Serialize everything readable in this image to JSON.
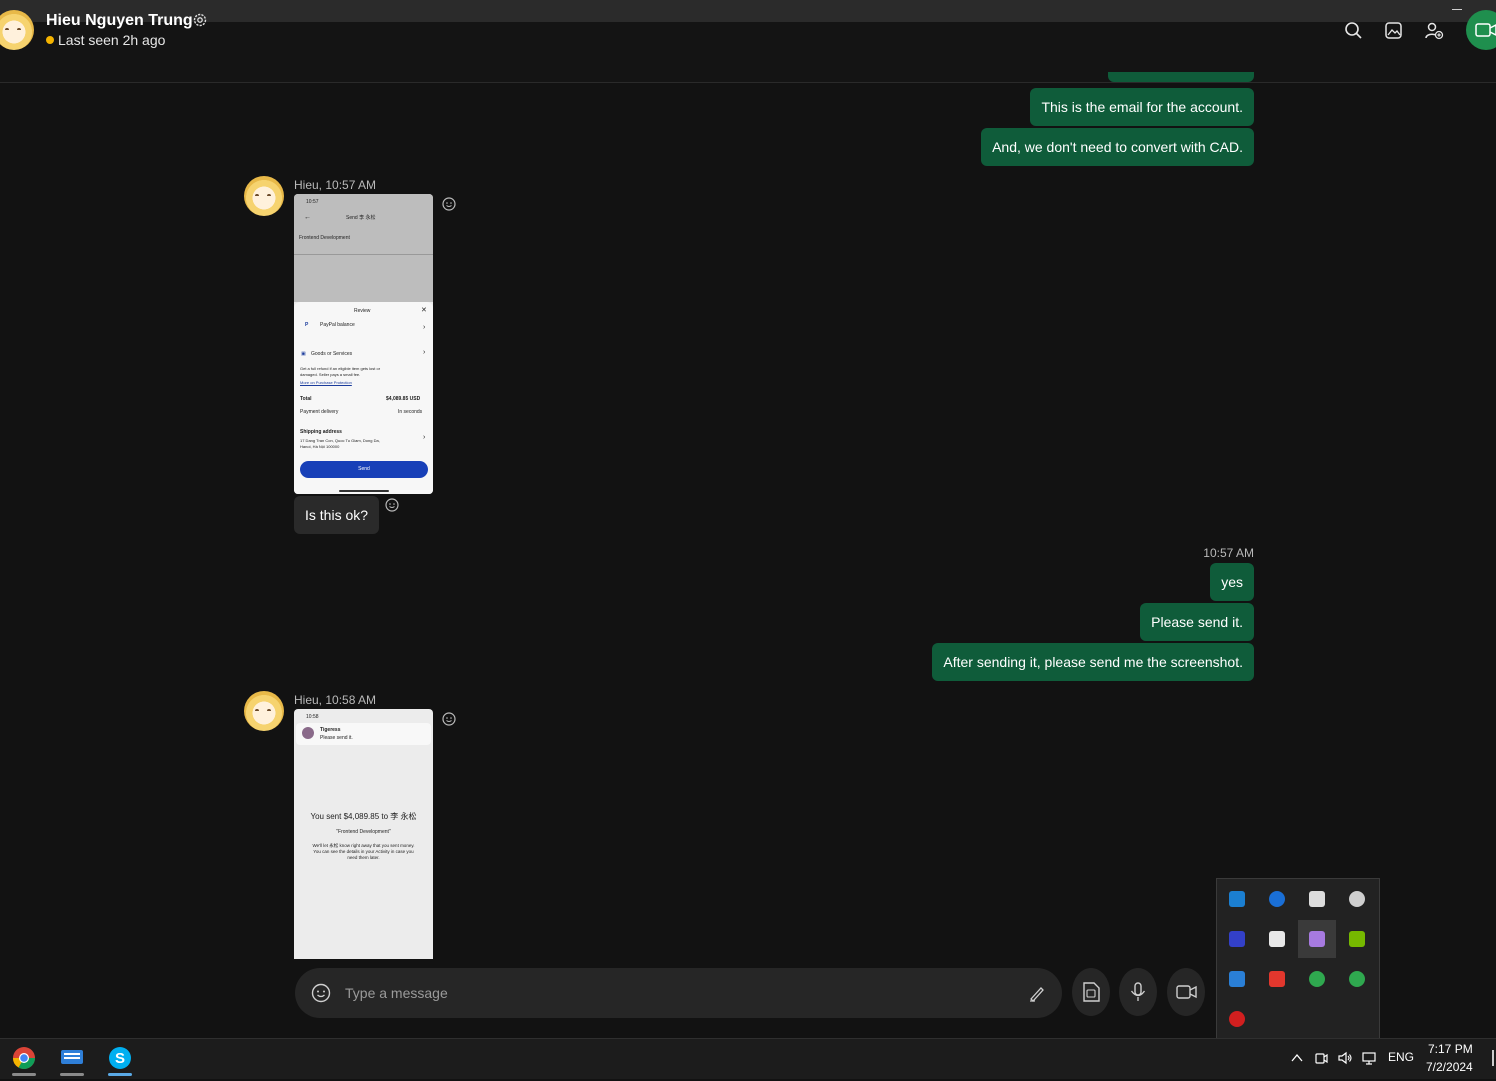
{
  "window": {
    "minimize_label": "—"
  },
  "header": {
    "contact_name": "Hieu Nguyen Trung",
    "status": "Last seen 2h ago",
    "icons": [
      "search-icon",
      "gallery-icon",
      "add-people-icon",
      "video-call-icon"
    ]
  },
  "messages": {
    "out_block_1": [
      "This is the email for the account.",
      "And, we don't need to convert with CAD."
    ],
    "in_block_1": {
      "sender_time": "Hieu, 10:57 AM",
      "screenshot": {
        "time": "10:57",
        "title": "Send 李 永松",
        "note": "Frontend Development",
        "review": "Review",
        "paypal": "PayPal balance",
        "goods": "Goods or Services",
        "protection_1": "Get a full refund if an eligible item gets lost or",
        "protection_2": "damaged. Seller pays a small fee.",
        "protection_link": "More on Purchase Protection",
        "total_label": "Total",
        "total_value": "$4,089.85 USD",
        "delivery_label": "Payment delivery",
        "delivery_value": "In seconds",
        "shipping_label": "Shipping address",
        "address_1": "17 Dang Tran Con, Quoc Tu Giam, Dong Da,",
        "address_2": "Hanoi, Hà Nội 100000",
        "send_button": "Send"
      },
      "text": "Is this ok?"
    },
    "out_block_2": {
      "time": "10:57 AM",
      "texts": [
        "yes",
        "Please send it.",
        "After sending it, please send me the screenshot."
      ]
    },
    "in_block_2": {
      "sender_time": "Hieu, 10:58 AM",
      "screenshot": {
        "time": "10:58",
        "name": "Tigeress",
        "message": "Please send it.",
        "sent": "You sent $4,089.85 to 李 永松",
        "note": "\"Frontend Development\"",
        "info_1": "We'll let 永松 know right away that you sent money.",
        "info_2": "You can see the details in your Activity in case you",
        "info_3": "need them later."
      }
    }
  },
  "composer": {
    "placeholder": "Type a message"
  },
  "taskbar": {
    "apps": [
      "chrome-icon",
      "touch-keyboard-icon",
      "skype-icon"
    ],
    "language": "ENG",
    "time": "7:17 PM",
    "date": "7/2/2024"
  },
  "tray_popup": {
    "icons": [
      "sync-icon",
      "bluetooth-icon",
      "security-shield-icon",
      "cloud-error-icon",
      "app-grid-icon",
      "slack-icon",
      "feather-pen-icon",
      "nvidia-icon",
      "remote-desktop-icon",
      "anydesk-icon",
      "green-check-icon",
      "green-check-icon",
      "record-icon"
    ]
  },
  "colors": {
    "outgoing_bubble": "#0f5c3a",
    "incoming_bubble": "#2a2a2a",
    "status_away": "#f5b400",
    "accent_green": "#1f8f4e"
  }
}
